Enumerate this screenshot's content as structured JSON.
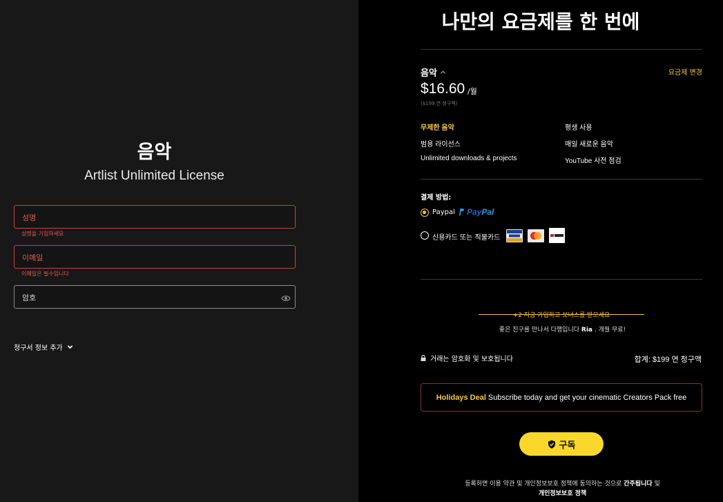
{
  "left": {
    "title": "음악",
    "subtitle": "Artlist Unlimited License",
    "name_placeholder": "성명",
    "name_error": "성명을 기입하세요",
    "email_placeholder": "이메일",
    "email_error": "이메일은 필수입니다",
    "password_placeholder": "암호",
    "billing_toggle": "청구서 정보 추가"
  },
  "right": {
    "title": "나만의 요금제를 한 번에",
    "plan_name": "음악",
    "change_plan": "요금제 변경",
    "price": "$16.60",
    "per_period": "/월",
    "yearly_note": "($199 연 청구액)",
    "features": {
      "col1": [
        "무제한 음악",
        "범용 라이선스",
        "Unlimited downloads & projects"
      ],
      "col2": [
        "평생 사용",
        "매일 새로운 음악",
        "YouTube 사전 점검"
      ]
    },
    "payment_label": "결제 방법:",
    "payment_options": {
      "paypal_label": "Paypal",
      "paypal_logo_1": "Pay",
      "paypal_logo_2": "Pal",
      "card_label": "신용카드 또는 직불카드",
      "selected": "paypal"
    },
    "bonus": "+2 지금 가입하고 보너스를 받으세요",
    "friend_pre": "좋은 친구를 만나서 다행입니다",
    "friend_name": "Ria",
    "friend_post": ". 개월 무료!",
    "secure_text": "거래는 암호화 및 보호됩니다",
    "total": "합계: $199 연 청구액",
    "deal_highlight": "Holidays Deal",
    "deal_text": "Subscribe today and get your cinematic Creators Pack free",
    "subscribe_label": "구독",
    "terms_pre": "등록하면 이용 약관 및 개인정보보호 정책에 동의하는 것으로",
    "terms_bold1": "간주됩니다",
    "terms_mid": "및",
    "terms_bold2": "개인정보보호 정책"
  },
  "colors": {
    "accent": "#f5c842",
    "error": "#e8564f",
    "button": "#f9d72d"
  }
}
